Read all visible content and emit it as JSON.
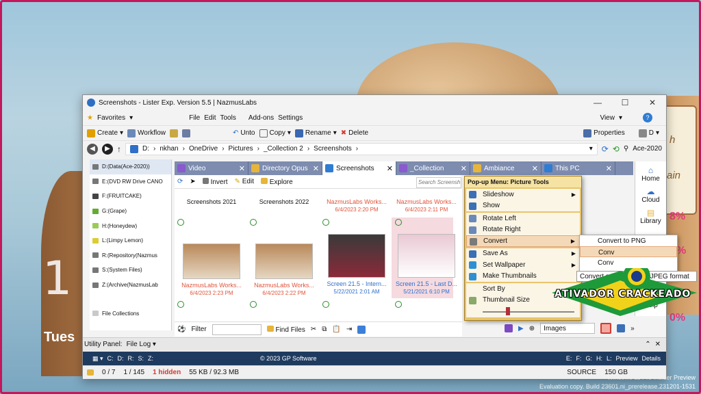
{
  "desktop": {
    "clock": "1",
    "day": "Tues",
    "note_lines": [
      "h",
      "ain"
    ],
    "pcts": [
      "8%",
      "%",
      "0%"
    ],
    "eval_line1": "Windows 11 Pro Insider Preview",
    "eval_line2": "Evaluation copy. Build 23601.ni_prerelease.231201-1531"
  },
  "window": {
    "title": "Screenshots - Lister Exp. Version 5.5 | NazmusLabs",
    "controls": [
      "—",
      "☐",
      "✕"
    ]
  },
  "menubar": {
    "favorites": "Favorites",
    "items": [
      "File",
      "Edit",
      "Tools",
      "Add-ons",
      "Settings"
    ],
    "view": "View",
    "help": "?"
  },
  "toolbar": {
    "create": "Create",
    "workflow": "Workflow",
    "undo": "Unto",
    "copy": "Copy",
    "rename": "Rename",
    "delete": "Delete",
    "properties": "Properties",
    "drive": "D"
  },
  "address": {
    "segments": [
      "D:",
      "nkhan",
      "OneDrive",
      "Pictures",
      "_Collection 2",
      "Screenshots"
    ],
    "computer": "Ace-2020"
  },
  "drives": [
    "D:(Data(Ace-2020))",
    "E:(DVD RW Drive CANO",
    "F:(FRUITCAKE)",
    "G:(Grape)",
    "H:(Honeydew)",
    "L:(Limpy Lemon)",
    "R:(Repository(Nazmus",
    "S:(System Files)",
    "Z:(Archive(NazmusLab"
  ],
  "file_collections": "File Collections",
  "tabs": [
    "Video",
    "Directory Opus",
    "Screenshots",
    "_Collection",
    "Ambiance",
    "This PC"
  ],
  "subtoolbar": {
    "invert": "Invert",
    "edit": "Edit",
    "explore": "Explore",
    "search": "Search Screensh"
  },
  "files": [
    {
      "name": "Screenshots 2021",
      "date": ""
    },
    {
      "name": "Screenshots 2022",
      "date": ""
    },
    {
      "name": "NazmusLabs Works...",
      "date": "6/4/2023 2:20 PM"
    },
    {
      "name": "NazmusLabs Works...",
      "date": "6/4/2023 2:11 PM"
    },
    {
      "name": "NazmusLabs Works...",
      "date": "6/4/2023 2:23 PM"
    },
    {
      "name": "NazmusLabs Works...",
      "date": "6/4/2023 2:22 PM"
    },
    {
      "name": "Screen 21.5 - Intern...",
      "date": "5/22/2021 2:01 AM"
    },
    {
      "name": "Screen 21.5 - Last D...",
      "date": "5/21/2021 6:10 PM"
    }
  ],
  "rightbar": {
    "home": "Home",
    "cloud": "Cloud",
    "library": "Library",
    "help": "Help"
  },
  "bottomtoolbar": {
    "filter": "Filter",
    "find": "Find Files",
    "images": "Images"
  },
  "utility": {
    "label": "Utility Panel:",
    "value": "File Log"
  },
  "drivebar": {
    "left": [
      "C:",
      "D:",
      "R:",
      "S:",
      "Z:"
    ],
    "copyright": "© 2023 GP Software",
    "right": [
      "E:",
      "F:",
      "G:",
      "H:",
      "L:"
    ],
    "preview": "Preview",
    "details": "Details"
  },
  "status": {
    "sel": "0 / 7",
    "count": "1 / 145",
    "hidden": "1 hidden",
    "size": "55 KB / 92.3 MB",
    "source": "SOURCE",
    "free": "150 GB"
  },
  "popup": {
    "header": "Pop-up Menu: Picture Tools",
    "items": [
      "Slideshow",
      "Show",
      "Rotate Left",
      "Rotate Right",
      "Convert",
      "Save As",
      "Set Wallpaper",
      "Make Thumbnails",
      "Sort By",
      "Thumbnail Size"
    ]
  },
  "submenu": {
    "items": [
      "Convert to PNG",
      "Conv",
      "Conv"
    ],
    "extra": "Convert sel",
    "jpeg": "JPEG format"
  },
  "watermark": {
    "text": "ATIVADOR CRACKEADO"
  },
  "colors": {
    "tabbar": "#7d8caf",
    "drivebar": "#1e3a5f",
    "popup": "#e8c46b",
    "accent": "#d23a2f"
  }
}
